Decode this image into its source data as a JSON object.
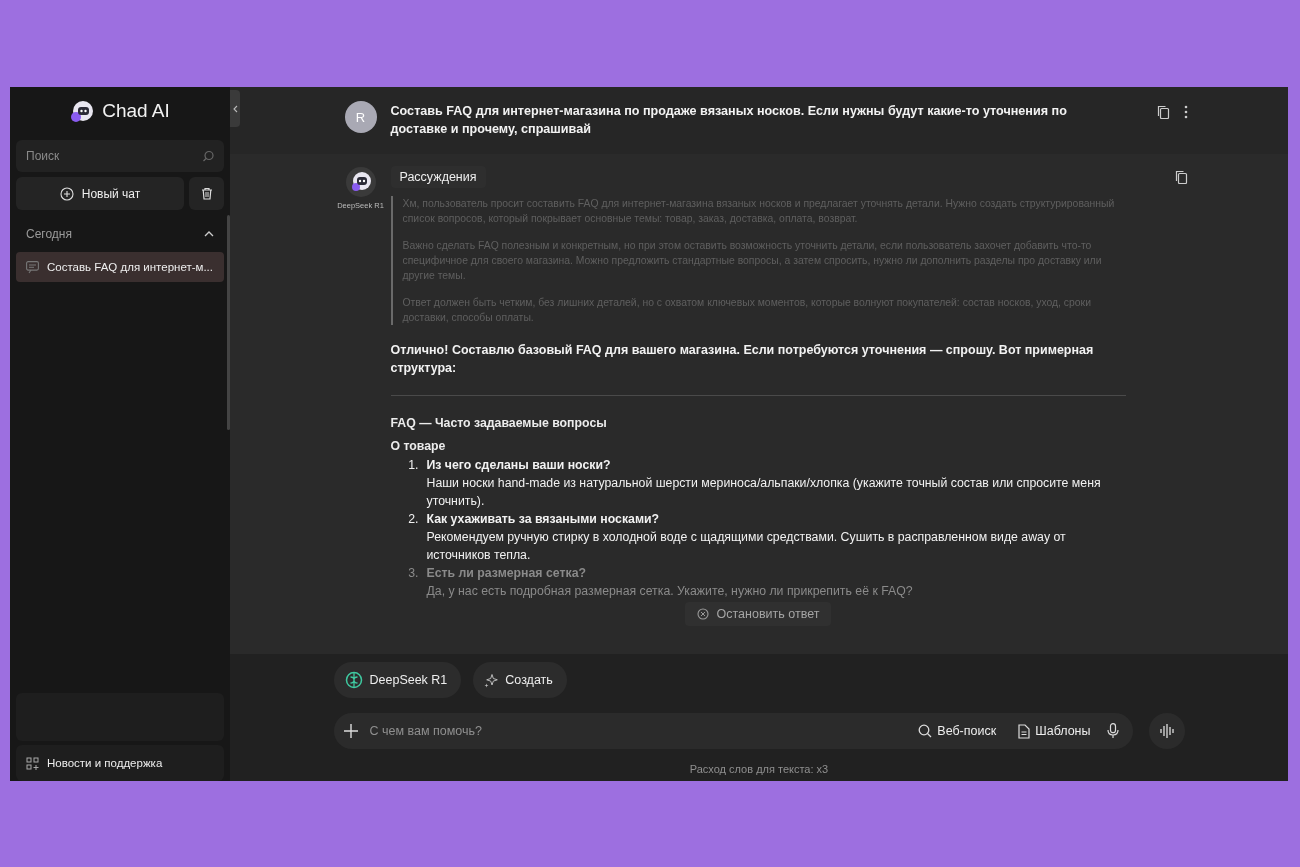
{
  "sidebar": {
    "logo_text": "Chad AI",
    "search": {
      "placeholder": "Поиск"
    },
    "new_chat": "Новый чат",
    "section": {
      "title": "Сегодня",
      "expanded": true
    },
    "chats": [
      {
        "title": "Составь FAQ для интернет-м...",
        "selected": true
      }
    ],
    "footer_link": "Новости и поддержка"
  },
  "conversation": {
    "user_message": {
      "avatar_letter": "R",
      "text": "Составь FAQ для интернет-магазина по продаже вязаных носков. Если нужны будут какие-то уточнения по доставке и прочему, спрашивай"
    },
    "assistant": {
      "model_name": "DeepSeek R1",
      "reasoning_label": "Рассуждения",
      "reasoning": [
        "Хм, пользователь просит составить FAQ для интернет-магазина вязаных носков и предлагает уточнять детали. Нужно создать структурированный список вопросов, который покрывает основные темы: товар, заказ, доставка, оплата, возврат.",
        "Важно сделать FAQ полезным и конкретным, но при этом оставить возможность уточнить детали, если пользователь захочет добавить что-то специфичное для своего магазина. Можно предложить стандартные вопросы, а затем спросить, нужно ли дополнить разделы про доставку или другие темы.",
        "Ответ должен быть четким, без лишних деталей, но с охватом ключевых моментов, которые волнуют покупателей: состав носков, уход, сроки доставки, способы оплаты."
      ],
      "intro": "Отлично! Составлю базовый FAQ для вашего магазина. Если потребуются уточнения — спрошу. Вот примерная структура:",
      "faq_title": "FAQ — Часто задаваемые вопросы",
      "section_title": "О товаре",
      "items": [
        {
          "number": "1.",
          "question": "Из чего сделаны ваши носки?",
          "answer": "Наши носки hand-made из натуральной шерсти мериноса/альпаки/хлопка (укажите точный состав или спросите меня уточнить).",
          "faded": false
        },
        {
          "number": "2.",
          "question": "Как ухаживать за вязаными носками?",
          "answer": "Рекомендуем ручную стирку в холодной воде с щадящими средствами. Сушить в расправленном виде away от источников тепла.",
          "faded": false
        },
        {
          "number": "3.",
          "question": "Есть ли размерная сетка?",
          "answer": "Да, у нас есть подробная размерная сетка. Укажите, нужно ли прикрепить её к FAQ?",
          "faded": true
        }
      ]
    }
  },
  "stop_button": "Остановить ответ",
  "model_chips": [
    {
      "label": "DeepSeek R1",
      "kind": "model"
    },
    {
      "label": "Создать",
      "kind": "create"
    }
  ],
  "composer": {
    "placeholder": "С чем вам помочь?",
    "tools": [
      {
        "label": "Веб-поиск",
        "kind": "search"
      },
      {
        "label": "Шаблоны",
        "kind": "templates"
      }
    ]
  },
  "footnote": "Расход слов для текста: x3"
}
